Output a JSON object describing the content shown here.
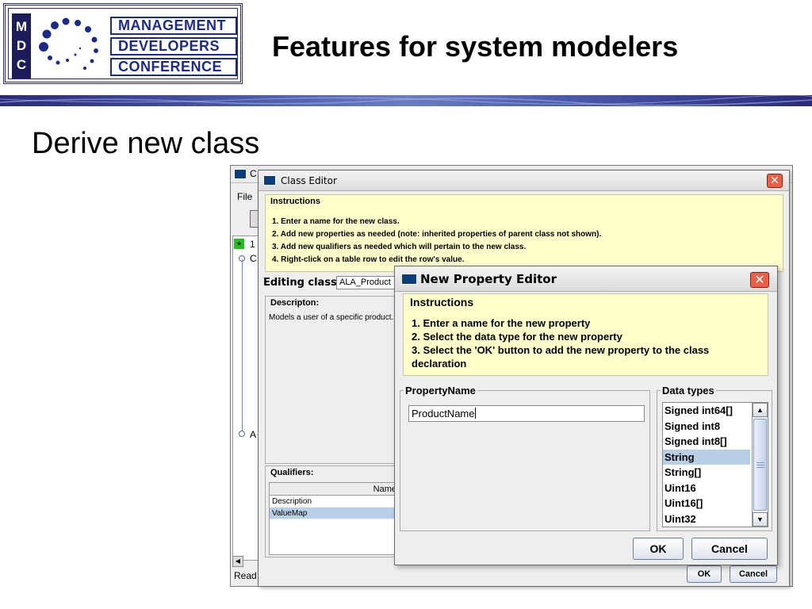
{
  "slide": {
    "title": "Features for system modelers",
    "subtitle": "Derive new class"
  },
  "logo": {
    "letters": [
      "M",
      "D",
      "C"
    ],
    "words": [
      "MANAGEMENT",
      "DEVELOPERS",
      "CONFERENCE"
    ]
  },
  "colors": {
    "brand_navy": "#1c2a8a",
    "instructions_bg": "#ffffcc",
    "selection": "#b8cfe5",
    "close_button": "#e8604a"
  },
  "background_window": {
    "title_fragment": "C",
    "menu_file": "File",
    "tree_fragments": [
      "1",
      "C",
      "A"
    ],
    "status_fragment": "Read",
    "scroll_left_icon": "arrow-left-icon"
  },
  "class_editor": {
    "title": "Class Editor",
    "instructions": {
      "legend": "Instructions",
      "lines": [
        "1. Enter a name for the new class.",
        "2. Add new properties as needed (note: inherited properties of parent class not shown).",
        "3. Add new qualifiers as needed which will pertain to the new class.",
        "4. Right-click on a table row to edit the row's value."
      ]
    },
    "editing_label": "Editing class",
    "editing_value": "ALA_Product",
    "description": {
      "legend": "Descripton:",
      "text": "Models a user of a specific product."
    },
    "qualifiers": {
      "legend": "Qualifiers:",
      "column_header": "Name",
      "rows": [
        {
          "name": "Description",
          "selected": false
        },
        {
          "name": "ValueMap",
          "selected": true
        }
      ]
    },
    "ok_label": "OK",
    "cancel_label": "Cancel"
  },
  "new_property_editor": {
    "title": "New Property Editor",
    "instructions": {
      "legend": "Instructions",
      "lines": [
        "1. Enter a name for the new property",
        "2. Select the data type for the new property",
        "3. Select the 'OK' button to add the new property to the class declaration"
      ]
    },
    "property_name": {
      "legend": "PropertyName",
      "value": "ProductName"
    },
    "data_types": {
      "legend": "Data types",
      "items": [
        "Signed int64[]",
        "Signed int8",
        "Signed int8[]",
        "String",
        "String[]",
        "Uint16",
        "Uint16[]",
        "Uint32"
      ],
      "selected": "String"
    },
    "ok_label": "OK",
    "cancel_label": "Cancel"
  }
}
